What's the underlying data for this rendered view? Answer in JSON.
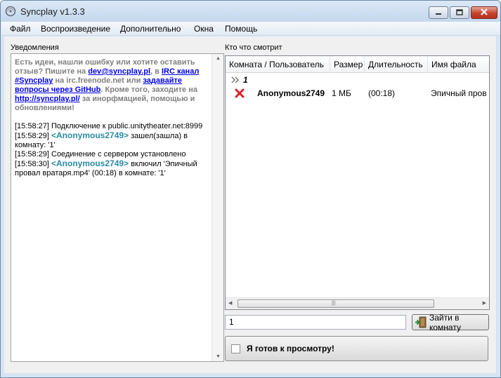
{
  "window": {
    "title": "Syncplay v1.3.3"
  },
  "menu": [
    "Файл",
    "Воспроизведение",
    "Дополнительно",
    "Окна",
    "Помощь"
  ],
  "left_pane": {
    "label": "Уведомления",
    "hint": {
      "p1": "Есть идеи, нашли ошибку или хотите оставить отзыв? Пишите на ",
      "email": "dev@syncplay.pl",
      "p2": ", в ",
      "irc": "IRC канал #Syncplay",
      "p3": " на irc.freenode.net или ",
      "github": "задавайте вопросы через GitHub",
      "p4": ". Кроме того, заходите на ",
      "site": "http://syncplay.pl/",
      "p5": " за инорфмацией, помощью и обновлениями!"
    },
    "log": [
      {
        "time": "[15:58:27]",
        "text": "Подключение к public.unitytheater.net:8999"
      },
      {
        "time": "[15:58:29]",
        "user": "<Anonymous2749>",
        "text": "зашел(зашла) в комнату: '1'"
      },
      {
        "time": "[15:58:29]",
        "text": "Соединение с сервером установлено"
      },
      {
        "time": "[15:58:30]",
        "user": "<Anonymous2749>",
        "text": "включил 'Эпичный провал вратаря.mp4' (00:18) в комнате: '1'"
      }
    ]
  },
  "right_pane": {
    "label": "Кто что смотрит",
    "columns": [
      "Комната / Пользователь",
      "Размер",
      "Длительность",
      "Имя файла"
    ],
    "room": "1",
    "users": [
      {
        "name": "Anonymous2749",
        "size": "1 МБ",
        "duration": "(00:18)",
        "file": "Эпичный пров"
      }
    ],
    "room_input": "1",
    "join_button": "Зайти в комнату",
    "ready_label": "Я готов к просмотру!"
  },
  "colors": {
    "accent_user": "#2a8aa5",
    "link": "#0000ee",
    "not_ready": "#d8232a"
  },
  "icons": {
    "app": "syncplay-icon",
    "not_ready": "cross-icon",
    "room": "room-chevron-icon"
  }
}
